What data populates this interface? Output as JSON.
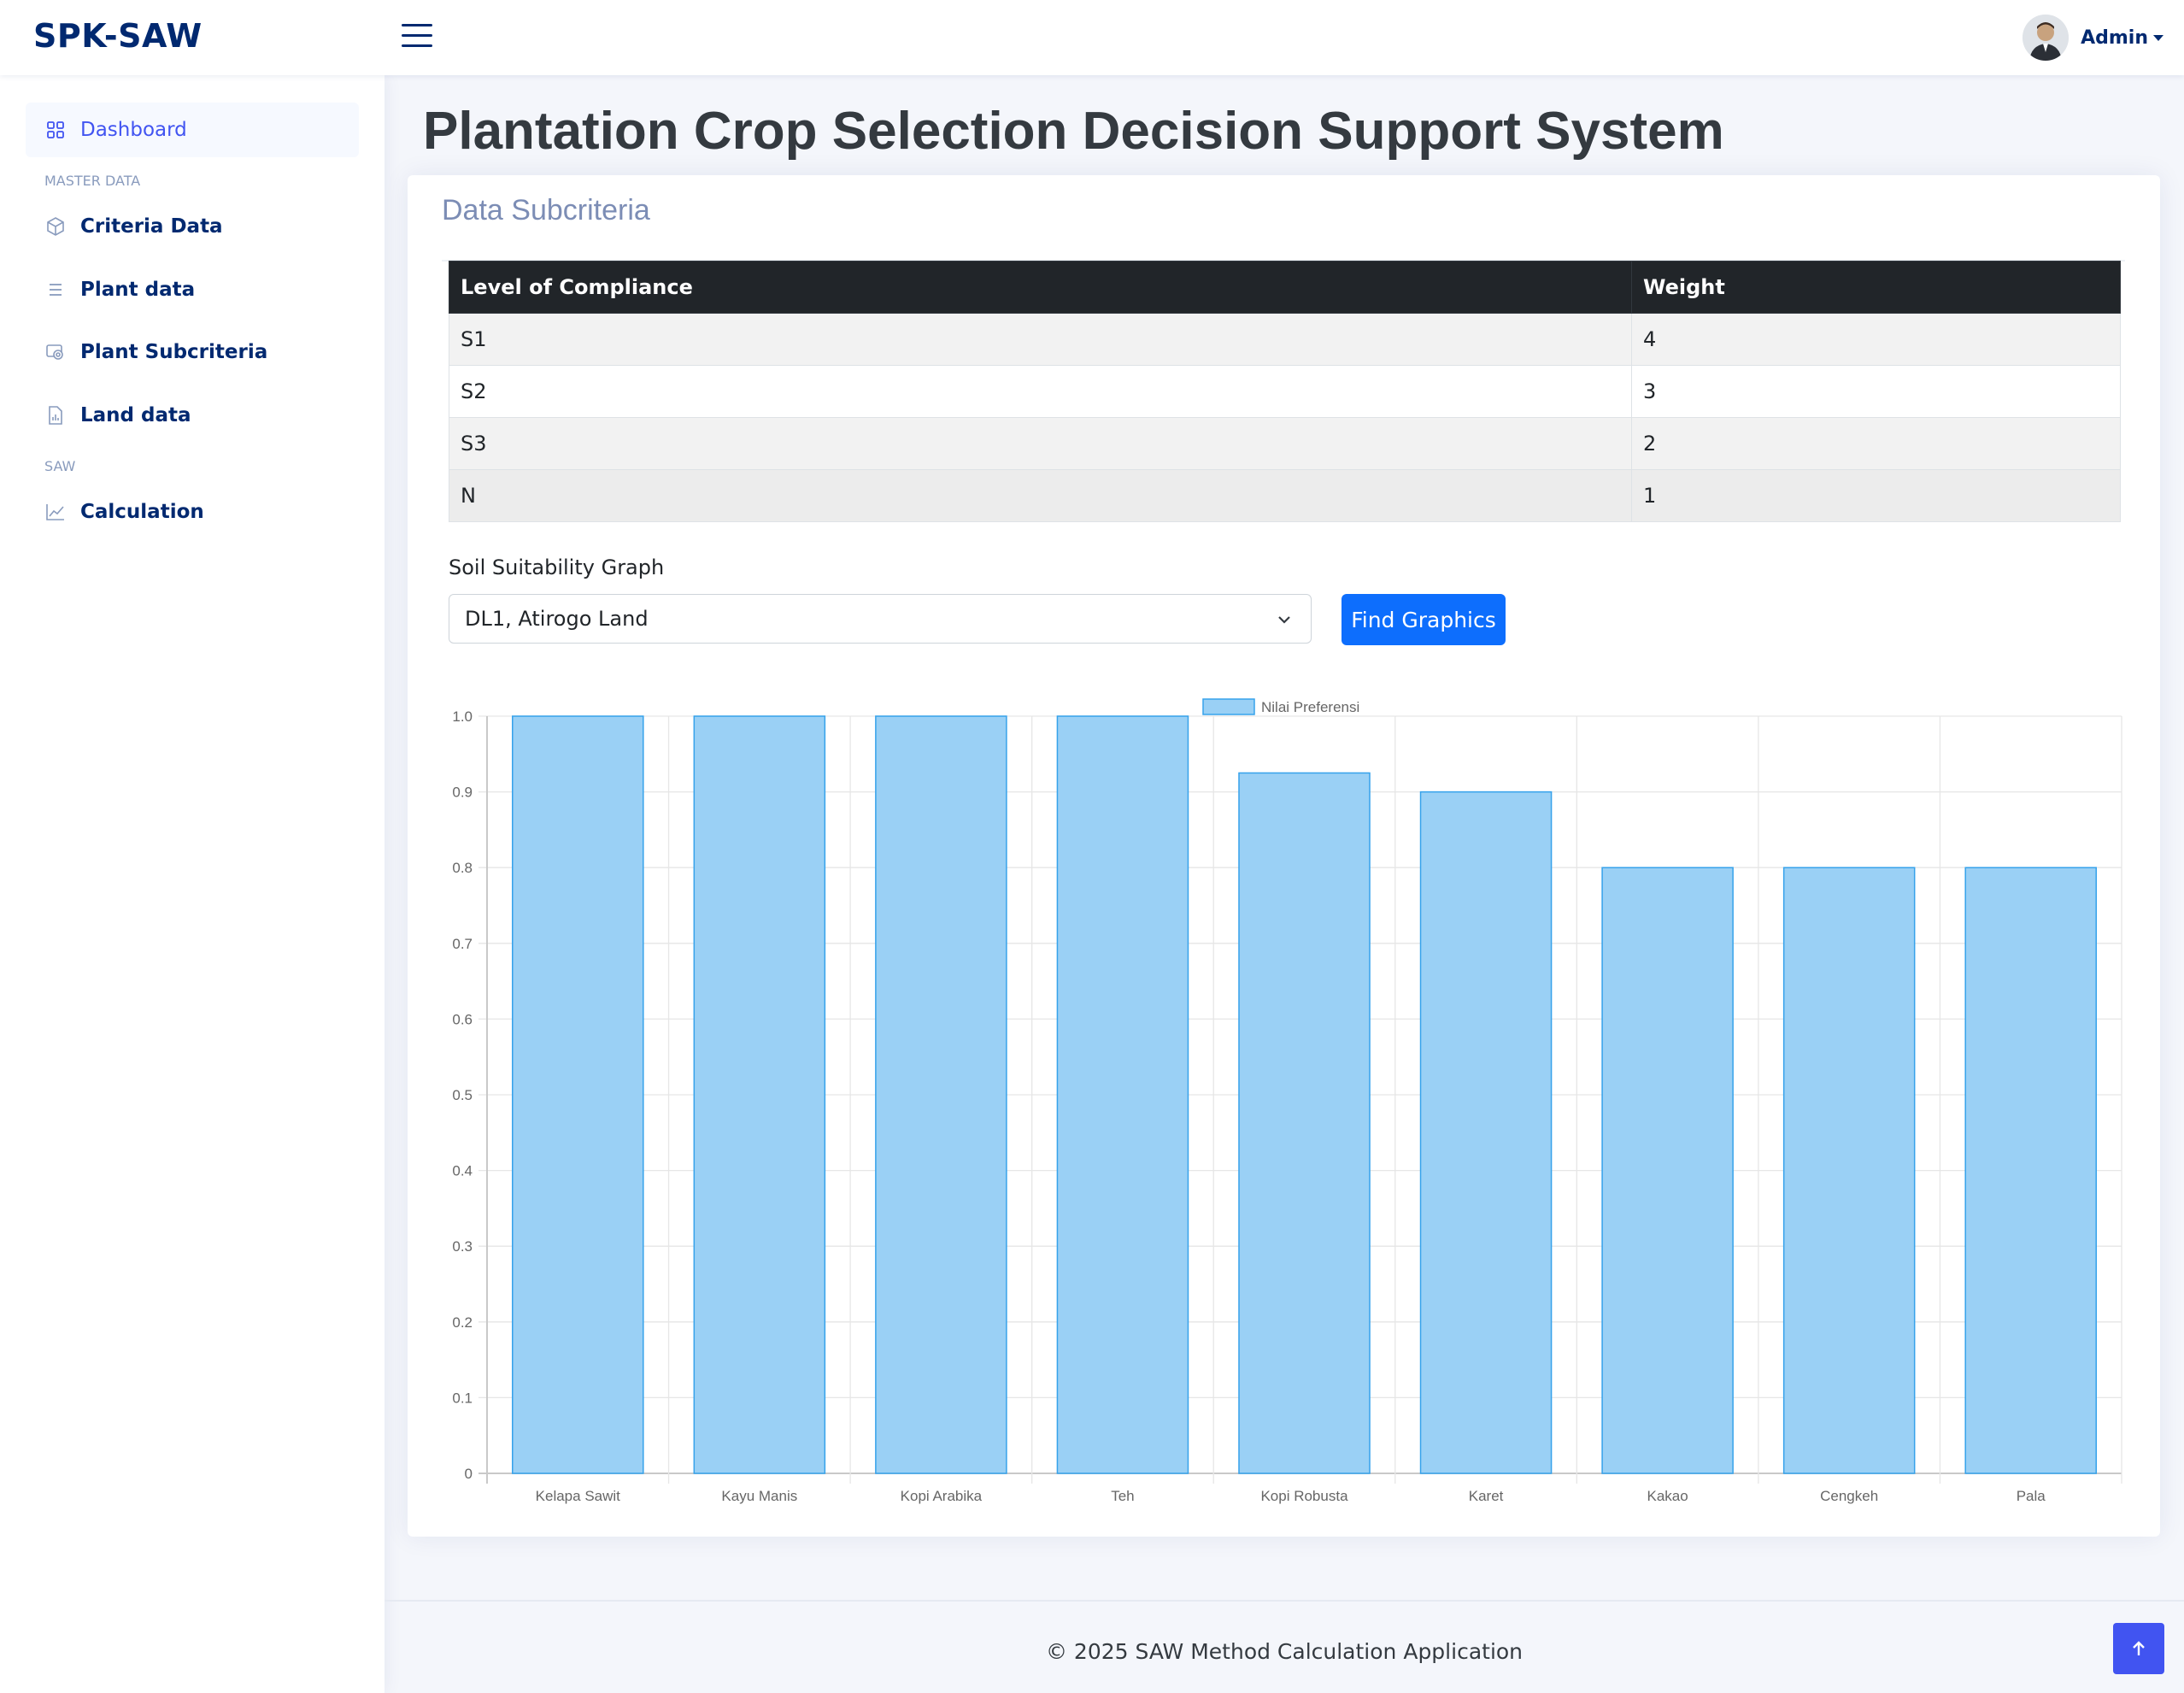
{
  "app": {
    "logo": "SPK-SAW",
    "user_name": "Admin"
  },
  "sidebar": {
    "items": [
      {
        "label": "Dashboard",
        "icon": "grid-icon"
      },
      {
        "heading": "MASTER DATA"
      },
      {
        "label": "Criteria Data",
        "icon": "cube-icon"
      },
      {
        "label": "Plant data",
        "icon": "list-icon"
      },
      {
        "label": "Plant Subcriteria",
        "icon": "card-icon"
      },
      {
        "label": "Land data",
        "icon": "file-chart-icon"
      },
      {
        "heading": "SAW"
      },
      {
        "label": "Calculation",
        "icon": "line-chart-icon"
      }
    ]
  },
  "main": {
    "title": "Plantation Crop Selection Decision Support System",
    "card_title": "Data Subcriteria",
    "table": {
      "headers": [
        "Level of Compliance",
        "Weight"
      ],
      "rows": [
        [
          "S1",
          "4"
        ],
        [
          "S2",
          "3"
        ],
        [
          "S3",
          "2"
        ],
        [
          "N",
          "1"
        ]
      ]
    },
    "graph_label": "Soil Suitability Graph",
    "land_select": "DL1, Atirogo Land",
    "find_button": "Find Graphics"
  },
  "chart_data": {
    "type": "bar",
    "categories": [
      "Kelapa Sawit",
      "Kayu Manis",
      "Kopi Arabika",
      "Teh",
      "Kopi Robusta",
      "Karet",
      "Kakao",
      "Cengkeh",
      "Pala"
    ],
    "series": [
      {
        "name": "Nilai Preferensi",
        "values": [
          1.0,
          1.0,
          1.0,
          1.0,
          0.925,
          0.9,
          0.8,
          0.8,
          0.8
        ]
      }
    ],
    "ylim": [
      0,
      1.0
    ],
    "yticks": [
      "0",
      "0.1",
      "0.2",
      "0.3",
      "0.4",
      "0.5",
      "0.6",
      "0.7",
      "0.8",
      "0.9",
      "1.0"
    ],
    "legend": "top-center",
    "grid": true,
    "colors": {
      "fill": "#9ad0f5",
      "stroke": "#36a2eb"
    }
  },
  "footer": {
    "text": "© 2025 SAW Method Calculation Application"
  },
  "colors": {
    "brand": "#012970",
    "accent": "#4154f1",
    "button": "#0d6efd"
  }
}
